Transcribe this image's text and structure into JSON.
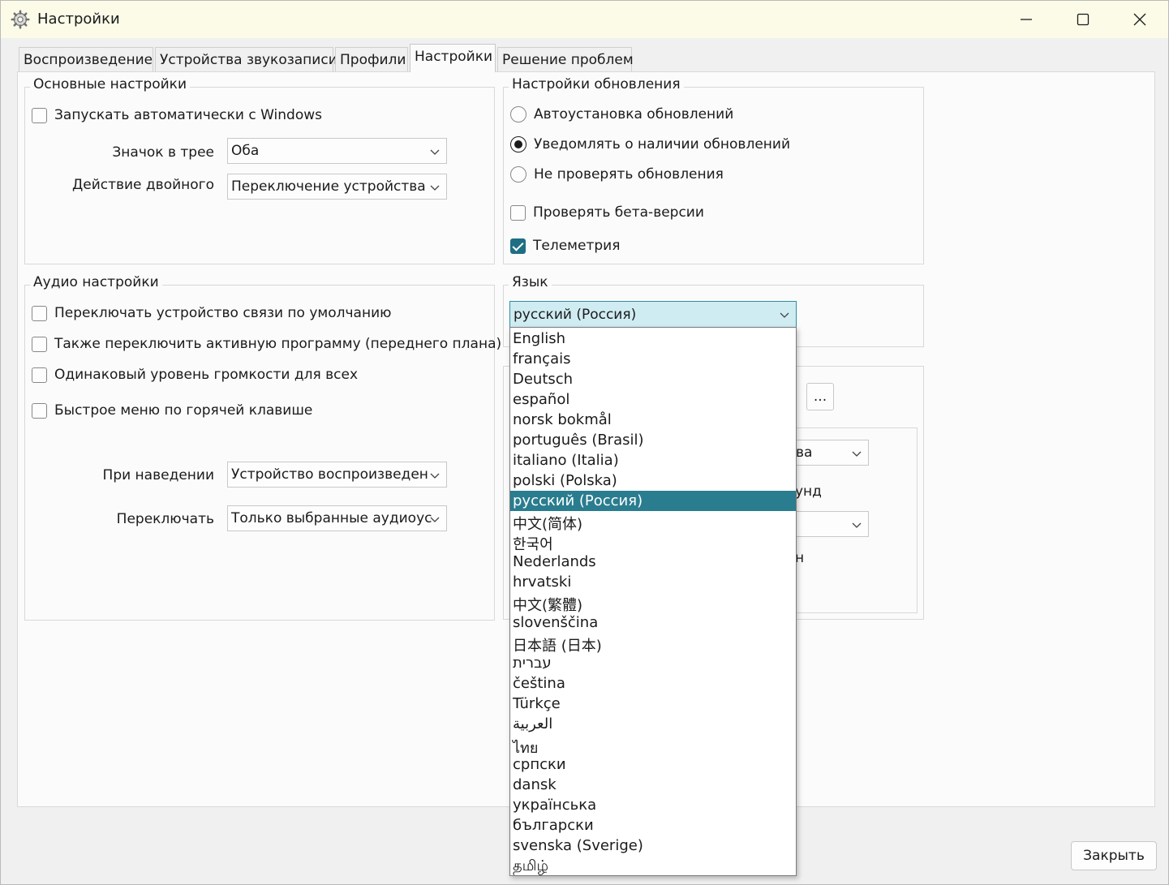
{
  "window": {
    "title": "Настройки",
    "app_icon": "gear-icon",
    "controls": [
      "minimize-icon",
      "maximize-icon",
      "close-icon"
    ]
  },
  "tabs": [
    {
      "label": "Воспроизведение",
      "active": false
    },
    {
      "label": "Устройства звукозаписи",
      "active": false
    },
    {
      "label": "Профили",
      "active": false
    },
    {
      "label": "Настройки",
      "active": true
    },
    {
      "label": "Решение проблем",
      "active": false
    }
  ],
  "basic": {
    "title": "Основные настройки",
    "autostart": {
      "label": "Запускать автоматически с Windows",
      "checked": false
    },
    "tray_icon": {
      "label": "Значок в трее",
      "value": "Оба"
    },
    "double_click": {
      "label": "Действие двойного",
      "value": "Переключение устройства"
    }
  },
  "updates": {
    "title": "Настройки обновления",
    "options": [
      {
        "label": "Автоустановка обновлений",
        "selected": false
      },
      {
        "label": "Уведомлять о наличии обновлений",
        "selected": true
      },
      {
        "label": "Не проверять обновления",
        "selected": false
      }
    ],
    "beta": {
      "label": "Проверять бета-версии",
      "checked": false
    },
    "telemetry": {
      "label": "Телеметрия",
      "checked": true
    }
  },
  "audio": {
    "title": "Аудио настройки",
    "checks": [
      {
        "label": "Переключать устройство связи по умолчанию",
        "checked": false
      },
      {
        "label": "Также переключить активную программу (переднего плана)",
        "checked": false
      },
      {
        "label": "Одинаковый уровень громкости для всех",
        "checked": false
      },
      {
        "label": "Быстрое меню по горячей клавише",
        "checked": false
      }
    ],
    "hover": {
      "label": "При наведении",
      "value": "Устройство воспроизведен"
    },
    "switch": {
      "label": "Переключать",
      "value": "Только выбранные аудиоус"
    }
  },
  "language": {
    "title": "Язык",
    "value": "русский (Россия)",
    "options": [
      "English",
      "français",
      "Deutsch",
      "español",
      "norsk bokmål",
      "português (Brasil)",
      "italiano (Italia)",
      "polski (Polska)",
      "русский (Россия)",
      "中文(简体)",
      "한국어",
      "Nederlands",
      "hrvatski",
      "中文(繁體)",
      "slovenščina",
      "日本語 (日本)",
      "עברית",
      "čeština",
      "Türkçe",
      "العربية",
      "ไทย",
      "српски",
      "dansk",
      "українська",
      "български",
      "svenska (Sverige)",
      "தமிழ்"
    ],
    "selected_index": 8
  },
  "hidden_group": {
    "more_button": "...",
    "fragment_1": "ва",
    "fragment_2": "унд",
    "fragment_3": "н"
  },
  "footer": {
    "close_label": "Закрыть"
  }
}
